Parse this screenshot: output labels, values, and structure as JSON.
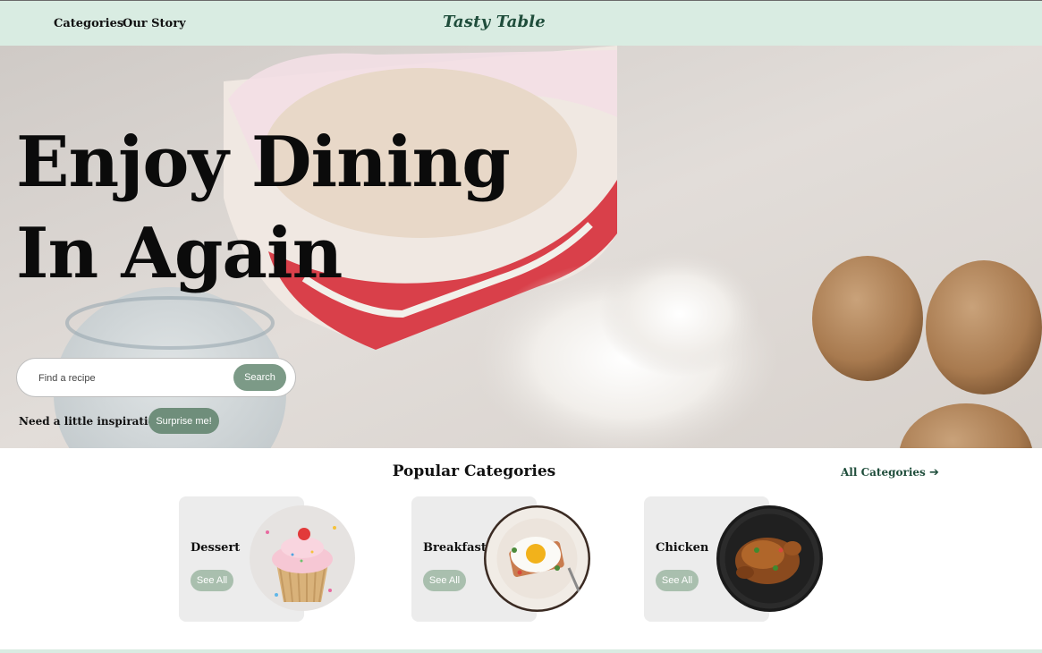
{
  "nav": {
    "links": [
      "Categories",
      "Our Story"
    ],
    "logo": "Tasty Table"
  },
  "hero": {
    "title_line1": "Enjoy Dining",
    "title_line2": "In Again",
    "search": {
      "placeholder": "Find a recipe",
      "value": "",
      "button_label": "Search"
    },
    "inspiration": {
      "label": "Need a little inspiration?",
      "button_label": "Surprise me!"
    }
  },
  "categories": {
    "title": "Popular Categories",
    "all_link": "All Categories",
    "all_link_icon": "arrow-right-icon",
    "items": [
      {
        "name": "Dessert",
        "button_label": "See All"
      },
      {
        "name": "Breakfast",
        "button_label": "See All"
      },
      {
        "name": "Chicken",
        "button_label": "See All"
      }
    ]
  },
  "colors": {
    "nav_bg": "#d9ece2",
    "brand": "#1f4d3b",
    "button": "#7c9a87",
    "card_bg": "#ececec",
    "see_all": "#a9bfae"
  }
}
